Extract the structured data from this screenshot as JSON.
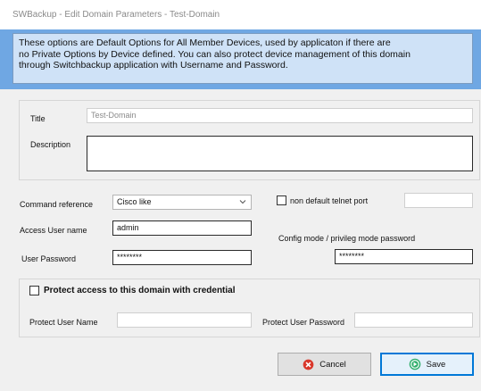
{
  "window": {
    "title": "SWBackup - Edit Domain Parameters - Test-Domain"
  },
  "info": {
    "lines": [
      "These options are Default Options for All Member Devices, used by applicaton if there are",
      "no Private Options by Device defined. You can also protect device management of this domain",
      "through Switchbackup application with Username and Password."
    ]
  },
  "domain": {
    "title_label": "Title",
    "title_value": "Test-Domain",
    "description_label": "Description",
    "description_value": ""
  },
  "settings": {
    "command_reference_label": "Command reference",
    "command_reference_value": "Cisco like",
    "non_default_telnet_label": "non default telnet port",
    "non_default_telnet_checked": false,
    "telnet_port_value": "",
    "access_user_label": "Access User name",
    "access_user_value": "admin",
    "config_mode_label": "Config mode / privileg mode password",
    "config_mode_value": "********",
    "user_password_label": "User Password",
    "user_password_value": "********"
  },
  "protect": {
    "checkbox_label": "Protect access to this domain with credential",
    "checked": false,
    "user_name_label": "Protect User Name",
    "user_name_value": "",
    "password_label": "Protect User Password",
    "password_value": ""
  },
  "buttons": {
    "cancel_label": "Cancel",
    "save_label": "Save"
  },
  "colors": {
    "info_band": "#6fa7e3",
    "info_box": "#cfe2f7",
    "cancel_icon": "#d9372b",
    "save_icon": "#2fae6a",
    "primary_border": "#0078d7"
  },
  "icons": {
    "cancel": "cancel-x-circle-icon",
    "save": "save-arrow-circle-icon",
    "dropdown": "chevron-down-icon"
  }
}
